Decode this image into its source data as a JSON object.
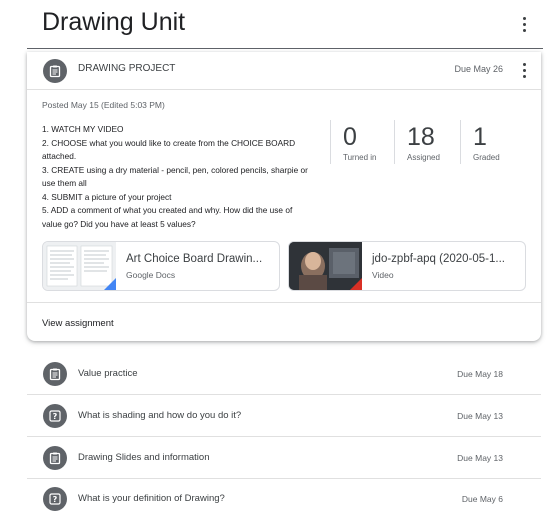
{
  "topic": {
    "title": "Drawing Unit"
  },
  "assignment": {
    "title": "DRAWING PROJECT",
    "due": "Due May 26",
    "posted": "Posted May 15 (Edited 5:03 PM)",
    "instructions": [
      "1. WATCH MY VIDEO",
      "2. CHOOSE what you would like to create from the CHOICE BOARD",
      "attached.",
      "3. CREATE using a dry material - pencil, pen, colored pencils, sharpie or",
      "use them all",
      "4. SUBMIT a picture of your project",
      "5. ADD a comment of what you created and why. How did the use of",
      "value go? Did you have at least 5 values?"
    ],
    "stats": [
      {
        "value": "0",
        "label": "Turned in"
      },
      {
        "value": "18",
        "label": "Assigned"
      },
      {
        "value": "1",
        "label": "Graded"
      }
    ],
    "attachments": [
      {
        "title": "Art Choice Board Drawin...",
        "type": "Google Docs"
      },
      {
        "title": "jdo-zpbf-apq (2020-05-1...",
        "type": "Video"
      }
    ],
    "view_label": "View assignment"
  },
  "items": [
    {
      "title": "Value practice",
      "due": "Due May 18",
      "icon": "assignment-icon"
    },
    {
      "title": "What is shading and how do you do it?",
      "due": "Due May 13",
      "icon": "question-icon"
    },
    {
      "title": "Drawing Slides and information",
      "due": "Due May 13",
      "icon": "assignment-icon"
    },
    {
      "title": "What is your definition of Drawing?",
      "due": "Due May 6",
      "icon": "question-icon"
    }
  ],
  "colors": {
    "icon_bg": "#5f6368",
    "docs_corner": "#4285f4",
    "video_corner": "#d93025"
  }
}
